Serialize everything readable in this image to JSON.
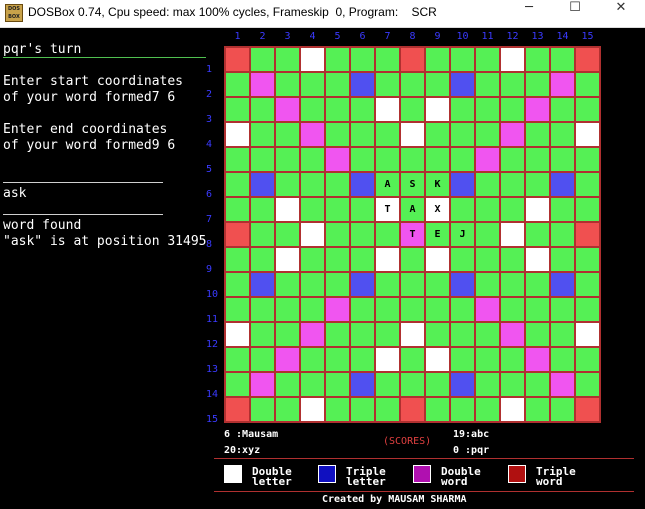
{
  "window": {
    "title": "DOSBox 0.74, Cpu speed: max 100% cycles, Frameskip  0, Program:    SCR",
    "icon_label": "DOS BOX",
    "minimize_glyph": "─",
    "maximize_glyph": "☐",
    "close_glyph": "✕"
  },
  "console": {
    "turn": "pqr's turn",
    "start_prompt_1": "Enter start coordinates",
    "start_prompt_2": "of your word formed7 6",
    "end_prompt_1": "Enter end coordinates",
    "end_prompt_2": "of your word formed9 6",
    "word": "ask",
    "status": "word found",
    "position": "\"ask\" is at position 31495"
  },
  "board": {
    "columns": [
      "1",
      "2",
      "3",
      "4",
      "5",
      "6",
      "7",
      "8",
      "9",
      "10",
      "11",
      "12",
      "13",
      "14",
      "15"
    ],
    "rows": [
      "1",
      "2",
      "3",
      "4",
      "5",
      "6",
      "7",
      "8",
      "9",
      "10",
      "11",
      "12",
      "13",
      "14",
      "15"
    ],
    "layout": [
      "R00W000R000W00R",
      "0M000B000B000M0",
      "00M000W0W000M00",
      "W00M000W000M00W",
      "0000M00000M0000",
      "0B000B000B000B0",
      "00W000W0W000W00",
      "R00W000S000W00R",
      "00W000W0W000W00",
      "0B000B000B000B0",
      "0000M00000M0000",
      "W00M000W000M00W",
      "00M000W0W000M00",
      "0M000B000B000M0",
      "R00W000R000W00R"
    ],
    "tiles": [
      {
        "row": 6,
        "col": 7,
        "letter": "A"
      },
      {
        "row": 6,
        "col": 8,
        "letter": "S"
      },
      {
        "row": 6,
        "col": 9,
        "letter": "K"
      },
      {
        "row": 7,
        "col": 7,
        "letter": "T"
      },
      {
        "row": 7,
        "col": 8,
        "letter": "A"
      },
      {
        "row": 7,
        "col": 9,
        "letter": "X"
      },
      {
        "row": 8,
        "col": 8,
        "letter": "T"
      },
      {
        "row": 8,
        "col": 9,
        "letter": "E"
      },
      {
        "row": 8,
        "col": 10,
        "letter": "J"
      }
    ],
    "colors": {
      "plain": "#55f055",
      "double_letter": "#ffffff",
      "triple_letter": "#5050f0",
      "double_word": "#f055f0",
      "triple_word": "#f05050",
      "grid_line": "#b03030",
      "number_color": "#3a3aff"
    }
  },
  "scores": {
    "heading": "(SCORES)",
    "p1": "6 :Mausam",
    "p2": "20:xyz",
    "p3": "19:abc",
    "p4": "0 :pqr"
  },
  "legend": [
    {
      "line1": "Double",
      "line2": "letter",
      "color": "#ffffff"
    },
    {
      "line1": "Triple",
      "line2": "letter",
      "color": "#1010c0"
    },
    {
      "line1": "Double",
      "line2": "word",
      "color": "#b010b0"
    },
    {
      "line1": "Triple",
      "line2": "word",
      "color": "#b01010"
    }
  ],
  "credit": "Created by MAUSAM SHARMA"
}
